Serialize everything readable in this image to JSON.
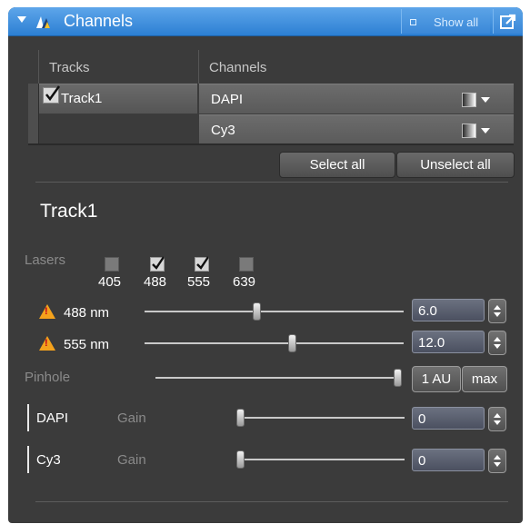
{
  "title_bar": {
    "title": "Channels",
    "show_all": "Show all"
  },
  "table": {
    "tracks_header": "Tracks",
    "channels_header": "Channels",
    "tracks": [
      {
        "name": "Track1",
        "checked": true
      }
    ],
    "channels": [
      {
        "name": "DAPI"
      },
      {
        "name": "Cy3"
      }
    ]
  },
  "buttons": {
    "select_all": "Select all",
    "unselect_all": "Unselect all"
  },
  "track_section": {
    "title": "Track1"
  },
  "lasers": {
    "label": "Lasers",
    "items": [
      {
        "wavelength": "405",
        "checked": false
      },
      {
        "wavelength": "488",
        "checked": true
      },
      {
        "wavelength": "555",
        "checked": true
      },
      {
        "wavelength": "639",
        "checked": false
      }
    ]
  },
  "laser_power": [
    {
      "label": "488 nm",
      "value": "6.0",
      "slider_fraction": 0.43
    },
    {
      "label": "555 nm",
      "value": "12.0",
      "slider_fraction": 0.57
    }
  ],
  "pinhole": {
    "label": "Pinhole",
    "value_label": "1 AU",
    "max_label": "max",
    "slider_fraction": 1.0
  },
  "gain": [
    {
      "channel": "DAPI",
      "label": "Gain",
      "value": "0",
      "slider_fraction": 0.0
    },
    {
      "channel": "Cy3",
      "label": "Gain",
      "value": "0",
      "slider_fraction": 0.0
    }
  ],
  "colors": {
    "title_bar": "#3a8ee0",
    "panel": "#3b3b3b",
    "warning": "#f4a21c"
  }
}
